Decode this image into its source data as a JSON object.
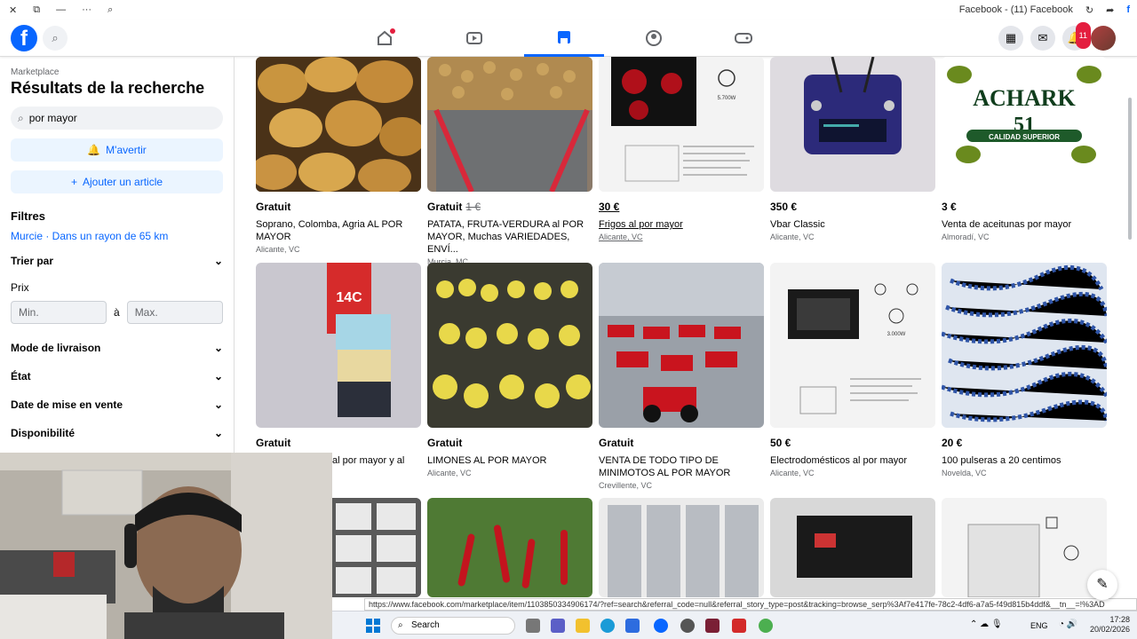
{
  "window": {
    "title": "Facebook - (11) Facebook"
  },
  "nav": {
    "notif_count": "11"
  },
  "sidebar": {
    "breadcrumb": "Marketplace",
    "title": "Résultats de la recherche",
    "search_value": "por mayor",
    "alert_label": "M'avertir",
    "add_label": "Ajouter un article",
    "filters_label": "Filtres",
    "location": "Murcie · Dans un rayon de 65 km",
    "sort_label": "Trier par",
    "price_label": "Prix",
    "min_placeholder": "Min.",
    "to_label": "à",
    "max_placeholder": "Max.",
    "delivery_label": "Mode de livraison",
    "condition_label": "État",
    "date_label": "Date de mise en vente",
    "availability_label": "Disponibilité"
  },
  "listings": [
    {
      "price": "Gratuit",
      "old_price": "",
      "title": "Soprano, Colomba, Agria AL POR MAYOR",
      "location": "Alicante, VC"
    },
    {
      "price": "Gratuit",
      "old_price": "1 €",
      "title": "PATATA, FRUTA-VERDURA al POR MAYOR, Muchas VARIEDADES, ENVÍ...",
      "location": "Murcia, MC"
    },
    {
      "price": "30 €",
      "old_price": "",
      "title": "Frigos al por mayor",
      "location": "Alicante, VC"
    },
    {
      "price": "350 €",
      "old_price": "",
      "title": "Vbar Classic",
      "location": "Alicante, VC"
    },
    {
      "price": "3 €",
      "old_price": "",
      "title": "Venta de aceitunas por mayor",
      "location": "Almoradí, VC"
    },
    {
      "price": "Gratuit",
      "old_price": "",
      "title": "al por mayor y al",
      "location": ""
    },
    {
      "price": "Gratuit",
      "old_price": "",
      "title": "LIMONES AL POR MAYOR",
      "location": "Alicante, VC"
    },
    {
      "price": "Gratuit",
      "old_price": "",
      "title": "VENTA DE TODO TIPO DE MINIMOTOS AL POR MAYOR",
      "location": "Crevillente, VC"
    },
    {
      "price": "50 €",
      "old_price": "",
      "title": "Electrodomésticos al por mayor",
      "location": "Alicante, VC"
    },
    {
      "price": "20 €",
      "old_price": "",
      "title": "100 pulseras a 20 centimos",
      "location": "Novelda, VC"
    }
  ],
  "image_text": {
    "olive_brand": "ACHARK",
    "olive_number": "51",
    "olive_tagline": "CALIDAD SUPERIOR",
    "phone_box": "14C",
    "hob_power": "5.700W",
    "oven_power": "3.000W"
  },
  "status_url": "https://www.facebook.com/marketplace/item/1103850334906174/?ref=search&referral_code=null&referral_story_type=post&tracking=browse_serp%3Af7e417fe-78c2-4df6-a7a5-f49d815b4ddf&__tn__=!%3AD",
  "taskbar": {
    "search_label": "Search",
    "lang": "ENG",
    "time": "17:28",
    "date": "20/02/2026"
  }
}
